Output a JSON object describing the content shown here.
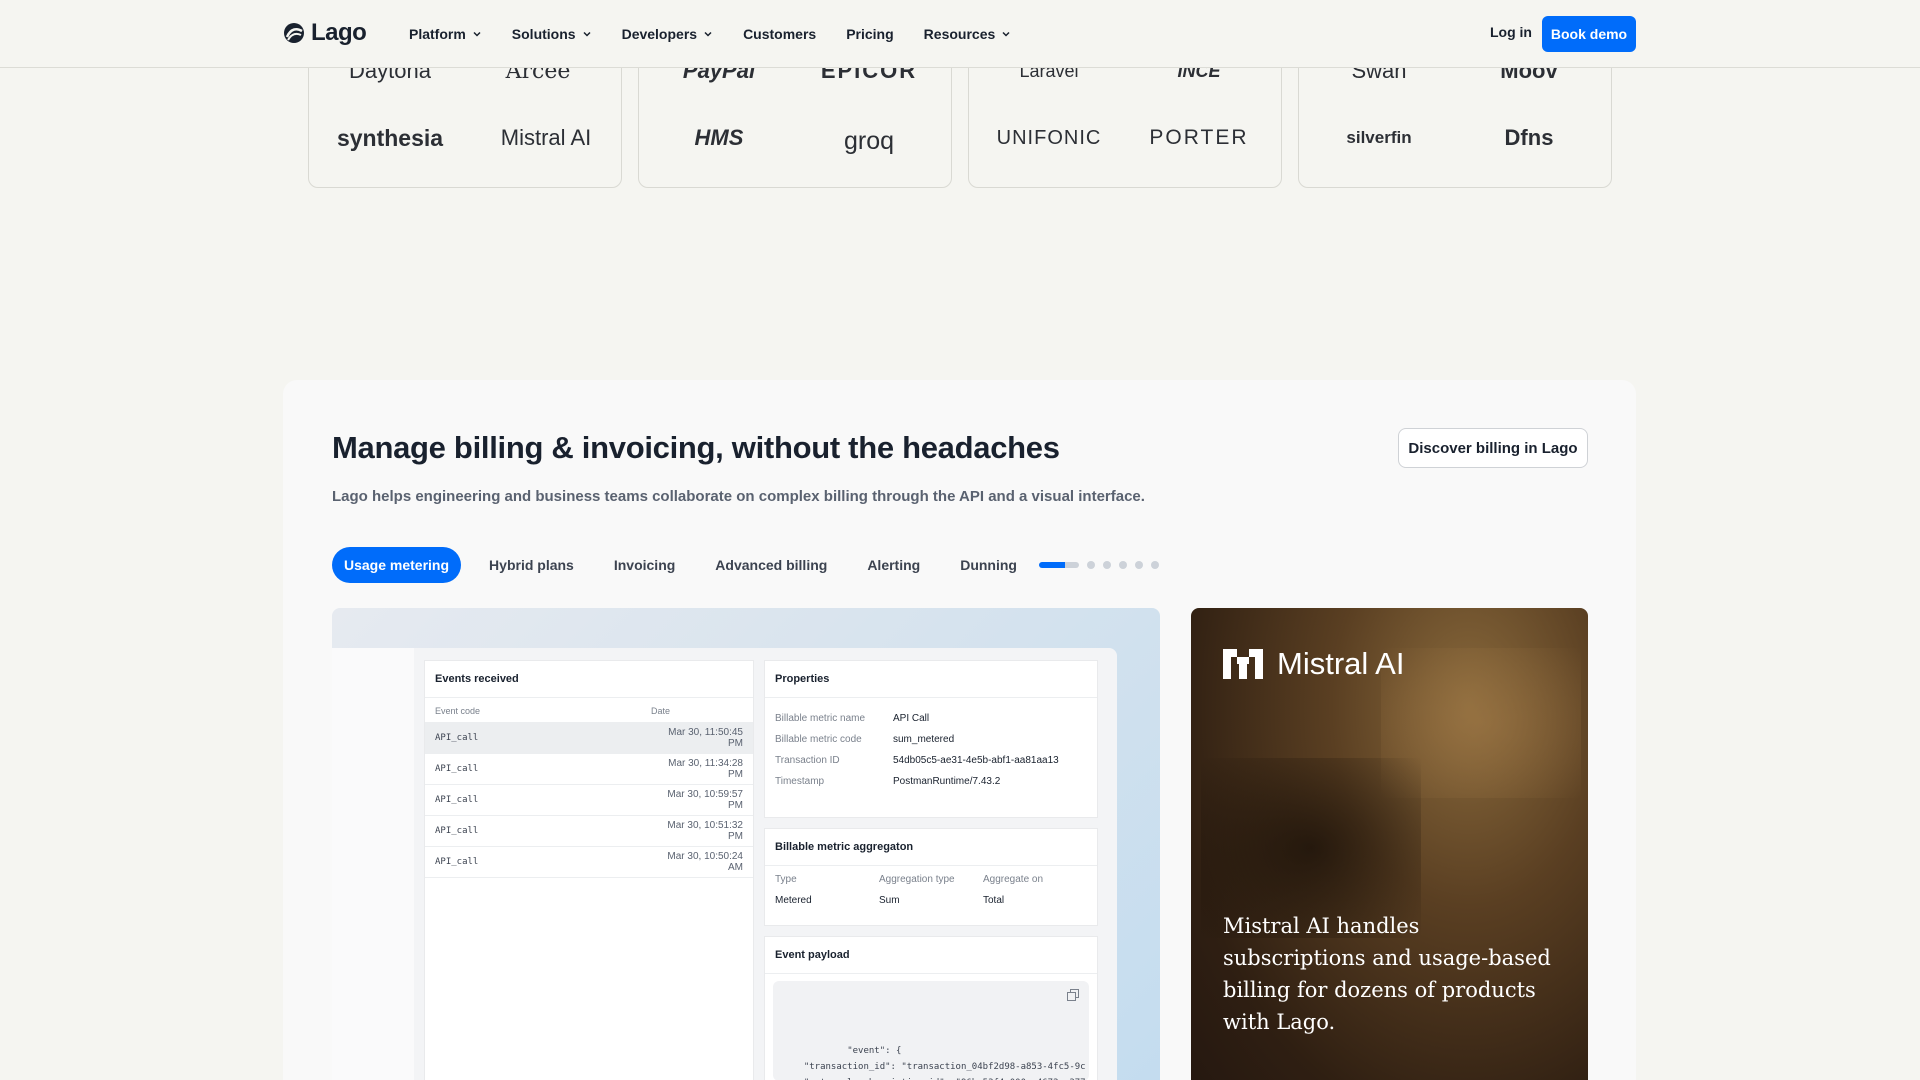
{
  "nav": {
    "logo_text": "Lago",
    "links": [
      {
        "label": "Platform",
        "dropdown": true
      },
      {
        "label": "Solutions",
        "dropdown": true
      },
      {
        "label": "Developers",
        "dropdown": true
      },
      {
        "label": "Customers",
        "dropdown": false
      },
      {
        "label": "Pricing",
        "dropdown": false
      },
      {
        "label": "Resources",
        "dropdown": true
      }
    ],
    "login_label": "Log in",
    "book_demo_label": "Book demo"
  },
  "logo_wall": {
    "cards": [
      [
        "Daytona",
        "Arcee",
        "synthesia",
        "Mistral AI"
      ],
      [
        "PayPal",
        "EPICOR",
        "HMS",
        "groq"
      ],
      [
        "Laravel",
        "INCE",
        "UNIFONIC",
        "PORTER"
      ],
      [
        "Swan",
        "Moov",
        "silverfin",
        "Dfns"
      ]
    ]
  },
  "section": {
    "title": "Manage billing & invoicing, without the headaches",
    "subtitle": "Lago helps engineering and business teams collaborate on complex billing through the API and a visual interface.",
    "discover_label": "Discover billing in Lago",
    "tabs": [
      "Usage metering",
      "Hybrid plans",
      "Invoicing",
      "Advanced billing",
      "Alerting",
      "Dunning"
    ],
    "active_tab": "Usage metering"
  },
  "mock": {
    "events": {
      "title": "Events received",
      "col_code": "Event code",
      "col_date": "Date",
      "rows": [
        {
          "code": "API_call",
          "date": "Mar 30, 11:50:45 PM"
        },
        {
          "code": "API_call",
          "date": "Mar 30, 11:34:28 PM"
        },
        {
          "code": "API_call",
          "date": "Mar 30, 10:59:57 PM"
        },
        {
          "code": "API_call",
          "date": "Mar 30, 10:51:32 PM"
        },
        {
          "code": "API_call",
          "date": "Mar 30, 10:50:24 AM"
        }
      ]
    },
    "properties": {
      "title": "Properties",
      "rows": [
        {
          "label": "Billable metric name",
          "value": "API Call"
        },
        {
          "label": "Billable metric code",
          "value": "sum_metered"
        },
        {
          "label": "Transaction ID",
          "value": "54db05c5-ae31-4e5b-abf1-aa81aa13"
        },
        {
          "label": "Timestamp",
          "value": "PostmanRuntime/7.43.2"
        }
      ]
    },
    "aggregation": {
      "title": "Billable metric aggregaton",
      "cols": [
        {
          "label": "Type",
          "value": "Metered"
        },
        {
          "label": "Aggregation type",
          "value": "Sum"
        },
        {
          "label": "Aggregate on",
          "value": "Total"
        }
      ]
    },
    "payload": {
      "title": "Event payload",
      "code": "\"event\": {\n  \"transaction_id\": \"transaction_04bf2d98-a853-4fc5-9c\n  \"external_subscription_id\": \"96bc53f4-000a-4672-a377\n  \"code\" : \"sum_metered\""
    }
  },
  "testimonial": {
    "brand": "Mistral AI",
    "quote": "Mistral AI handles subscriptions and usage-based billing for dozens of products with Lago."
  }
}
